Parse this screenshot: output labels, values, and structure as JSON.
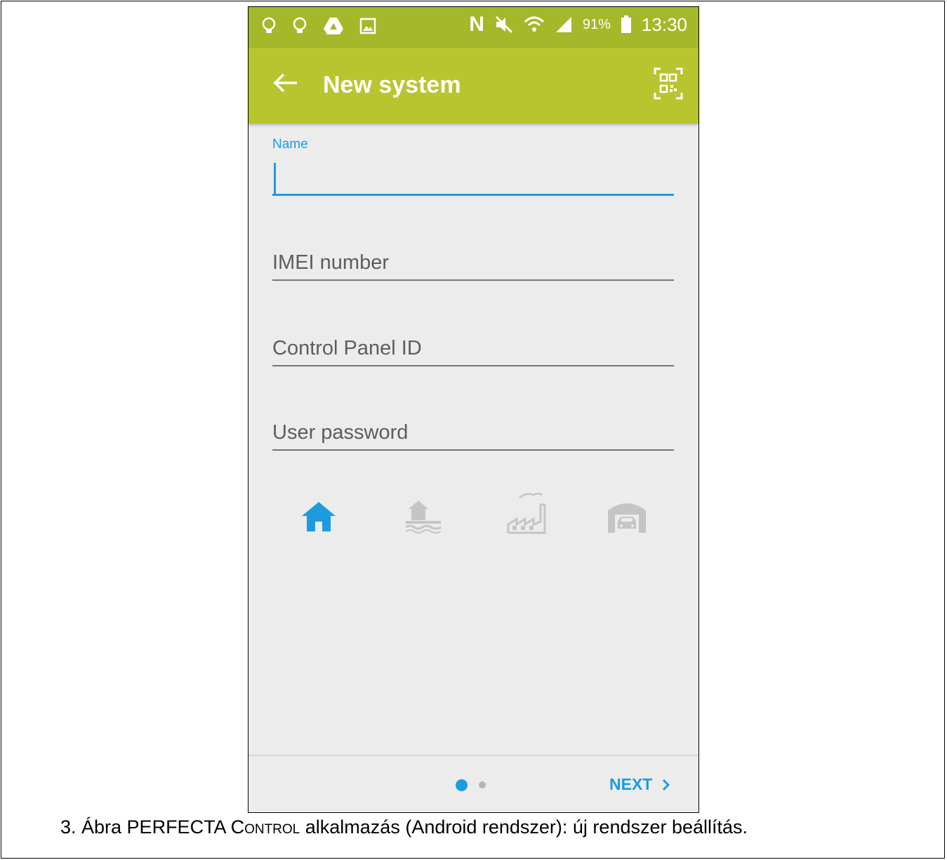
{
  "status_bar": {
    "battery": "91%",
    "time": "13:30",
    "network_icon": "N"
  },
  "app_bar": {
    "title": "New system",
    "back_icon": "arrow-left",
    "action_icon": "qr-code"
  },
  "form": {
    "name_label": "Name",
    "name_value": "",
    "imei_placeholder": "IMEI number",
    "panel_id_placeholder": "Control Panel ID",
    "password_placeholder": "User password"
  },
  "system_types": [
    {
      "icon": "house-icon",
      "selected": true
    },
    {
      "icon": "lake-house-icon",
      "selected": false
    },
    {
      "icon": "factory-icon",
      "selected": false
    },
    {
      "icon": "garage-icon",
      "selected": false
    }
  ],
  "pager": {
    "pages": 2,
    "current": 1,
    "next_label": "NEXT"
  },
  "colors": {
    "accent": "#1e9be0",
    "appbar": "#b8c52f",
    "statusbar": "#a4b82a",
    "background": "#ececec"
  },
  "caption": {
    "part1": "3. Ábra PERFECTA C",
    "part2": "ontrol",
    "part3": " alkalmazás (Android rendszer): új rendszer beállítás."
  }
}
